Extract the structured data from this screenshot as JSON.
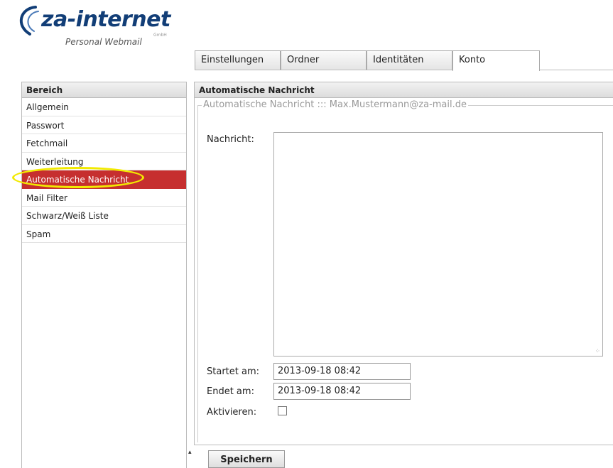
{
  "brand": {
    "name": "za-internet",
    "legal_form": "GmbH",
    "subtitle": "Personal Webmail",
    "color": "#123e77"
  },
  "tabs": [
    {
      "label": "Einstellungen",
      "active": false
    },
    {
      "label": "Ordner",
      "active": false
    },
    {
      "label": "Identitäten",
      "active": false
    },
    {
      "label": "Konto",
      "active": true
    }
  ],
  "sidebar": {
    "header": "Bereich",
    "items": [
      {
        "label": "Allgemein",
        "selected": false
      },
      {
        "label": "Passwort",
        "selected": false
      },
      {
        "label": "Fetchmail",
        "selected": false
      },
      {
        "label": "Weiterleitung",
        "selected": false
      },
      {
        "label": "Automatische Nachricht",
        "selected": true
      },
      {
        "label": "Mail Filter",
        "selected": false
      },
      {
        "label": "Schwarz/Weiß Liste",
        "selected": false
      },
      {
        "label": "Spam",
        "selected": false
      }
    ],
    "selected_color": "#c62f2f",
    "highlight_color": "#f2ea00"
  },
  "panel": {
    "title": "Automatische Nachricht",
    "legend": "Automatische Nachricht ::: Max.Mustermann@za-mail.de",
    "message_label": "Nachricht:",
    "message_value": "",
    "start_label": "Startet am:",
    "start_value": "2013-09-18 08:42",
    "end_label": "Endet am:",
    "end_value": "2013-09-18 08:42",
    "activate_label": "Aktivieren:",
    "activate_checked": false,
    "save_label": "Speichern"
  }
}
